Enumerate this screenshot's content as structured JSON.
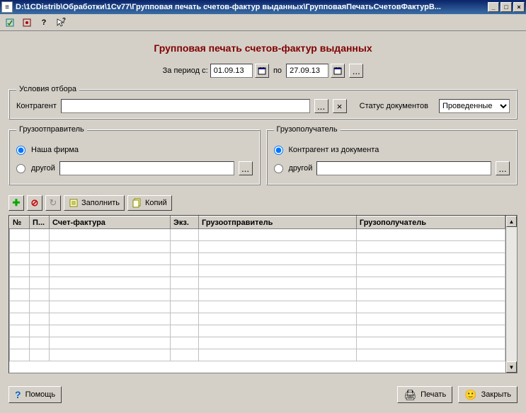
{
  "window": {
    "title": "D:\\1CDistrib\\Обработки\\1Cv77\\Групповая печать счетов-фактур выданных\\ГрупповаяПечатьСчетовФактурВ..."
  },
  "main_title": "Групповая печать счетов-фактур выданных",
  "period": {
    "label_from": "За период с:",
    "date_from": "01.09.13",
    "label_to": "по",
    "date_to": "27.09.13"
  },
  "filter": {
    "legend": "Условия отбора",
    "counterparty_label": "Контрагент",
    "counterparty_value": "",
    "status_label": "Статус документов",
    "status_value": "Проведенные"
  },
  "sender": {
    "legend": "Грузоотправитель",
    "opt1": "Наша фирма",
    "opt2": "другой",
    "other_value": ""
  },
  "receiver": {
    "legend": "Грузополучатель",
    "opt1": "Контрагент из документа",
    "opt2": "другой",
    "other_value": ""
  },
  "actions": {
    "fill": "Заполнить",
    "copies": "Копий"
  },
  "table": {
    "col_n": "№",
    "col_p": "П...",
    "col_invoice": "Счет-фактура",
    "col_ekz": "Экз.",
    "col_sender": "Грузоотправитель",
    "col_receiver": "Грузополучатель"
  },
  "footer": {
    "help": "Помощь",
    "print": "Печать",
    "close": "Закрыть"
  }
}
